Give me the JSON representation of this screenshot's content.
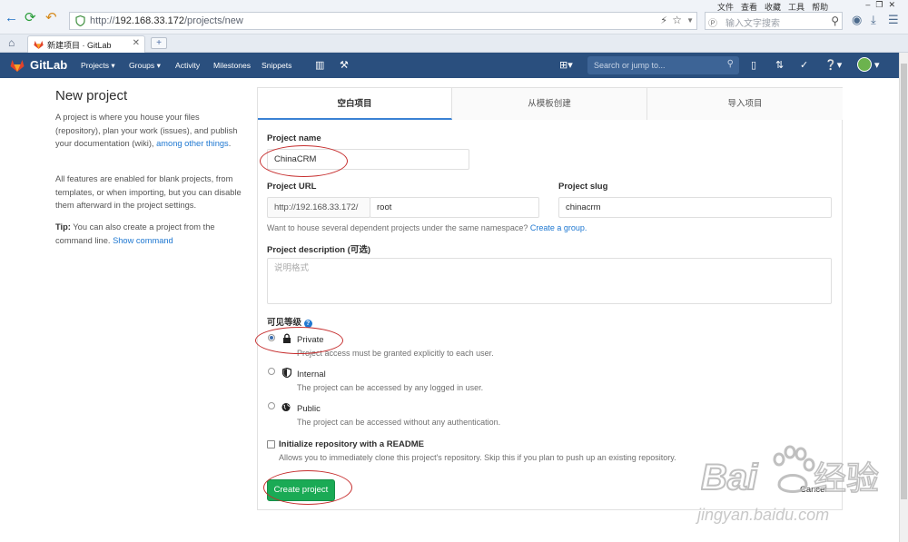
{
  "browser": {
    "url_prefix": "http://",
    "url_host": "192.168.33.172",
    "url_path": "/projects/new",
    "menu": [
      "文件",
      "查看",
      "收藏",
      "工具",
      "帮助"
    ],
    "search_placeholder": "输入文字搜索",
    "tab_title": "新建项目 · GitLab",
    "new_tab_label": "+"
  },
  "gitlab_header": {
    "brand": "GitLab",
    "nav": [
      "Projects",
      "Groups",
      "Activity",
      "Milestones",
      "Snippets"
    ],
    "search_placeholder": "Search or jump to..."
  },
  "sidebar": {
    "title": "New project",
    "p1_text": "A project is where you house your files (repository), plan your work (issues), and publish your documentation (wiki),",
    "p1_link": "among other things",
    "p2": "All features are enabled for blank projects, from templates, or when importing, but you can disable them afterward in the project settings.",
    "tip_label": "Tip:",
    "tip_text": "You can also create a project from the command line.",
    "tip_link": "Show command"
  },
  "tabs": [
    "空白项目",
    "从模板创建",
    "导入项目"
  ],
  "form": {
    "project_name_label": "Project name",
    "project_name_value": "ChinaCRM",
    "project_url_label": "Project URL",
    "url_prefix": "http://192.168.33.172/",
    "namespace": "root",
    "project_slug_label": "Project slug",
    "project_slug_value": "chinacrm",
    "namespace_hint": "Want to house several dependent projects under the same namespace?",
    "namespace_hint_link": "Create a group.",
    "description_label": "Project description (可选)",
    "description_placeholder": "说明格式",
    "visibility_label": "可见等级",
    "visibility": [
      {
        "name": "Private",
        "desc": "Project access must be granted explicitly to each user.",
        "checked": true
      },
      {
        "name": "Internal",
        "desc": "The project can be accessed by any logged in user.",
        "checked": false
      },
      {
        "name": "Public",
        "desc": "The project can be accessed without any authentication.",
        "checked": false
      }
    ],
    "readme_label": "Initialize repository with a README",
    "readme_desc": "Allows you to immediately clone this project's repository. Skip this if you plan to push up an existing repository.",
    "create_button": "Create project",
    "cancel_button": "Cancel"
  },
  "watermark": {
    "text": "Baidu经验",
    "url": "jingyan.baidu.com"
  },
  "colors": {
    "header": "#2a4f7e",
    "create_button": "#1aaa55",
    "link": "#1f78d1",
    "annotation": "#c62e2e"
  }
}
